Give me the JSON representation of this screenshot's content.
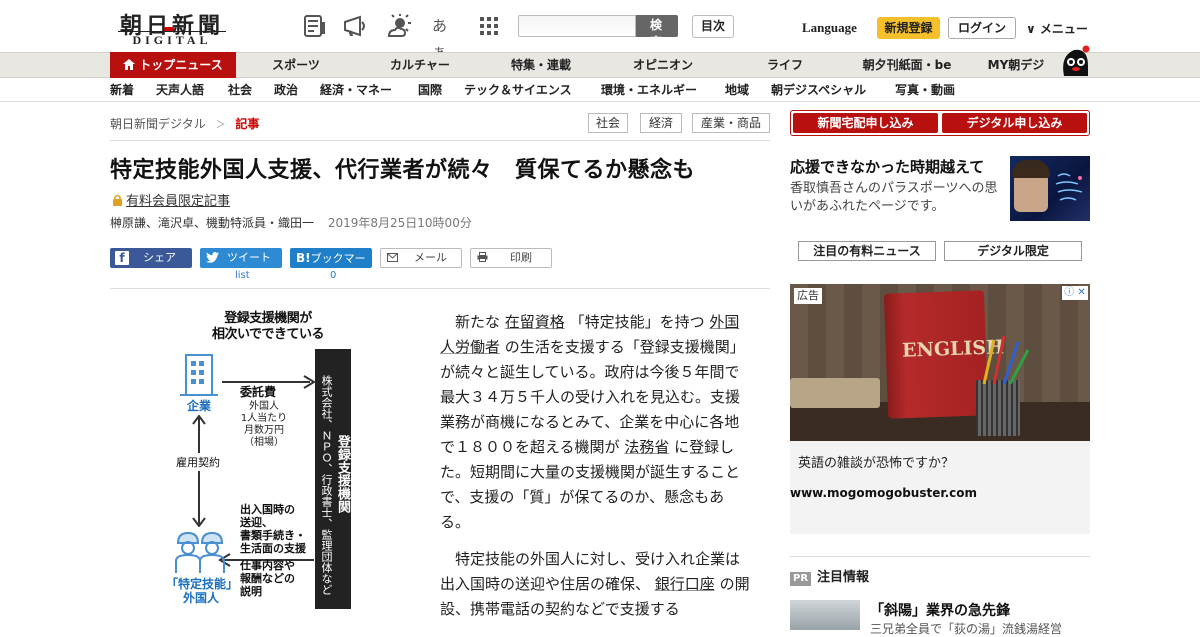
{
  "header": {
    "logo_main": "朝日新聞",
    "logo_sub": "DIGITAL",
    "icons": [
      "newspaper-icon",
      "megaphone-icon",
      "weather-icon",
      "font-size-icon",
      "grid-icon"
    ],
    "font_size_label": "あぁ",
    "search_placeholder": "",
    "search_label": "検 索",
    "toc_label": "目次",
    "language_label": "Language",
    "register_label": "新規登録",
    "login_label": "ログイン",
    "menu_label": "∨ メニュー",
    "accent": "#b80f0f",
    "register_color": "#f5c02a"
  },
  "nav_primary": {
    "top_news": "トップニュース",
    "items": [
      "スポーツ",
      "カルチャー",
      "特集・連載",
      "オピニオン",
      "ライフ",
      "朝夕刊紙面・be",
      "MY朝デジ"
    ]
  },
  "nav_secondary": {
    "items": [
      "新着",
      "天声人語",
      "社会",
      "政治",
      "経済・マネー",
      "国際",
      "テック＆サイエンス",
      "環境・エネルギー",
      "地域",
      "朝デジスペシャル",
      "写真・動画"
    ]
  },
  "breadcrumb": {
    "home": "朝日新聞デジタル",
    "sep": "＞",
    "current": "記事"
  },
  "tags": [
    "社会",
    "経済",
    "産業・商品"
  ],
  "article": {
    "title": "特定技能外国人支援、代行業者が続々　質保てるか懸念も",
    "members_label": "有料会員限定記事",
    "byline": "榊原謙、滝沢卓、機動特派員・織田一",
    "date": "2019年8月25日10時00分",
    "share": {
      "facebook": "シェア",
      "twitter": "ツイート",
      "twitter_count": "list",
      "hatena": "ブックマーク",
      "hatena_icon": "B!",
      "hatena_count": "0",
      "mail": "メール",
      "print": "印刷"
    },
    "p1": {
      "t1": "新たな",
      "link1": "在留資格",
      "t2": "「特定技能」を持つ",
      "link2": "外国人労働者",
      "t3": "の生活を支援する「登録支援機関」が続々と誕生している。政府は今後５年間で最大３４万５千人の受け入れを見込む。支援業務が商機になるとみて、企業を中心に各地で１８００を超える機関が",
      "link3": "法務省",
      "t4": "に登録した。短期間に大量の支援機関が誕生することで、支援の「質」が保てるのか、懸念もある。"
    },
    "p2": {
      "t1": "特定技能の外国人に対し、受け入れ企業は出入国時の送迎や住居の確保、",
      "link1": "銀行口座",
      "t2": "の開設、携帯電話の契約などで支援する"
    }
  },
  "figure": {
    "title1": "登録支援機関が",
    "title2": "相次いでできている",
    "company": "企業",
    "fee": "委託費",
    "fee_note1": "外国人",
    "fee_note2": "1人当たり",
    "fee_note3": "月数万円",
    "fee_note4": "（相場）",
    "contract": "雇用契約",
    "org_main": "登録支援機関",
    "org_sub": "株式会社、ＮＰＯ、行政書士、監理団体など",
    "support1": "出入国時の",
    "support2": "送迎、",
    "support3": "書類手続き・",
    "support4": "生活面の支援",
    "job1": "仕事内容や",
    "job2": "報酬などの",
    "job3": "説明",
    "worker1": "「特定技能」",
    "worker2": "外国人"
  },
  "sidebar": {
    "btn_newspaper": "新聞宅配申し込み",
    "btn_digital": "デジタル申し込み",
    "promo_title": "応援できなかった時期越えて",
    "promo_desc": "香取慎吾さんのパラスポーツへの思いがあふれたページです。",
    "tab1": "注目の有料ニュース",
    "tab2": "デジタル限定",
    "ad_label": "広告",
    "ad_close": "ⓘ ✕",
    "ad_book": "ENGLISH",
    "ad_text": "英語の雑談が恐怖ですか？",
    "ad_url": "www.mogomogobuster.com",
    "pr_badge": "PR",
    "pr_head": "注目情報",
    "pr_title": "「斜陽」業界の急先鋒",
    "pr_sub": "三兄弟全員で「荻の湯」流銭湯経営"
  }
}
